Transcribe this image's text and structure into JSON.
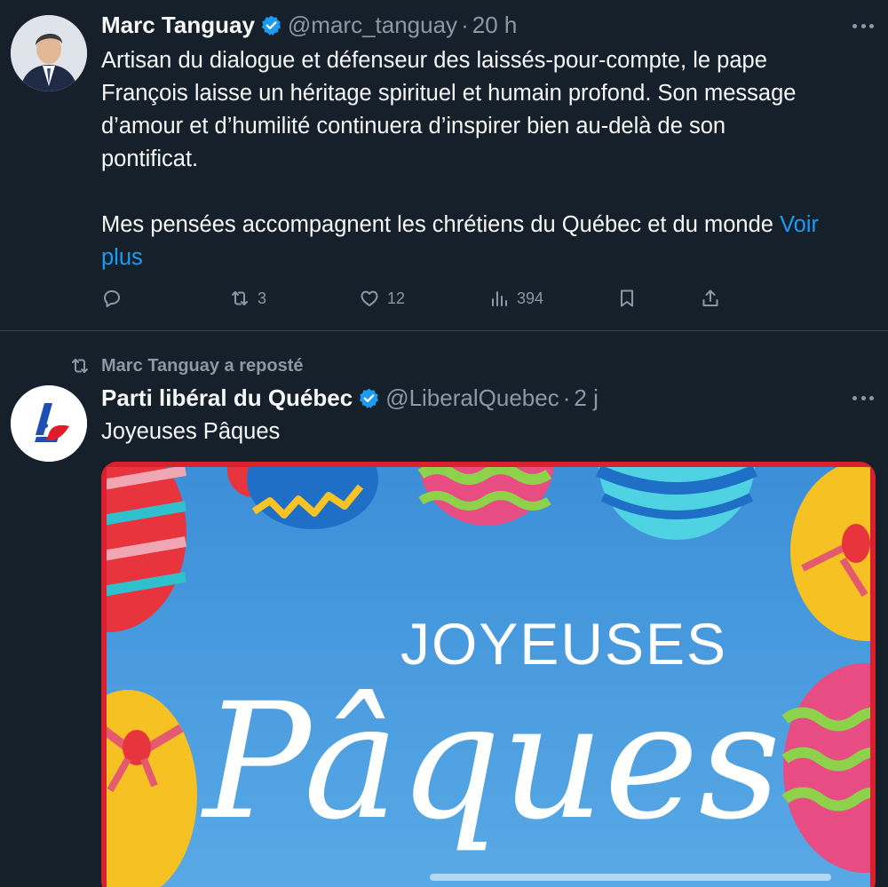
{
  "tweet1": {
    "author_name": "Marc Tanguay",
    "handle": "@marc_tanguay",
    "separator": "·",
    "time": "20 h",
    "text_lines": [
      "Artisan du dialogue et défenseur des laissés-pour-compte, le pape",
      "François laisse un héritage spirituel et humain profond. Son message",
      "d’amour et d’humilité continuera d’inspirer bien au-delà de son",
      "pontificat."
    ],
    "text_second_paragraph": "Mes pensées accompagnent les chrétiens du Québec et du monde ",
    "see_more_word1": "Voir",
    "see_more_word2": "plus",
    "actions": {
      "reply_icon": "reply-icon",
      "retweet_count": "3",
      "like_count": "12",
      "views_count": "394",
      "bookmark_icon": "bookmark-icon",
      "share_icon": "share-icon"
    }
  },
  "tweet2": {
    "repost_label": "Marc Tanguay a reposté",
    "author_name": "Parti libéral du Québec",
    "handle": "@LiberalQuebec",
    "separator": "·",
    "time": "2 j",
    "text": "Joyeuses Pâques",
    "media": {
      "headline": "JOYEUSES",
      "script_text": "Pâques"
    }
  },
  "colors": {
    "background": "#15202b",
    "text": "#f7f9f9",
    "secondary": "#8b98a5",
    "link": "#1d9bf0",
    "verified": "#1d9bf0",
    "divider": "#38444d"
  }
}
